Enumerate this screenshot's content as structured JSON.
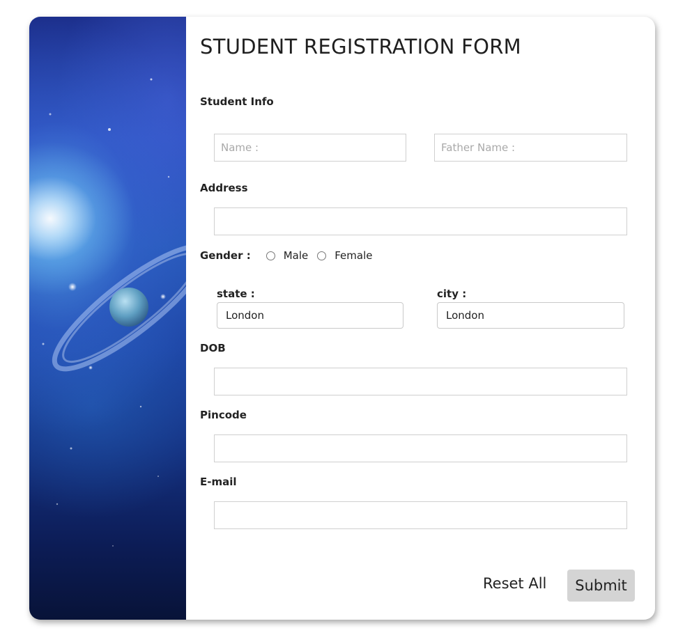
{
  "form": {
    "title": "STUDENT REGISTRATION FORM",
    "sections": {
      "student_info": "Student Info",
      "address": "Address",
      "gender": "Gender :",
      "state": "state :",
      "city": "city :",
      "dob": "DOB",
      "pincode": "Pincode",
      "email": "E-mail"
    },
    "fields": {
      "name": {
        "placeholder": "Name :",
        "value": ""
      },
      "father_name": {
        "placeholder": "Father Name :",
        "value": ""
      },
      "address": {
        "placeholder": "",
        "value": ""
      },
      "dob": {
        "placeholder": "",
        "value": ""
      },
      "pincode": {
        "placeholder": "",
        "value": ""
      },
      "email": {
        "placeholder": "",
        "value": ""
      }
    },
    "gender_options": [
      "Male",
      "Female"
    ],
    "state_selected": "London",
    "city_selected": "London",
    "buttons": {
      "reset": "Reset All",
      "submit": "Submit"
    }
  },
  "colors": {
    "submit_bg": "#d4d4d4",
    "border": "#cfcfcf",
    "space_dark": "#0c1c55",
    "space_light": "#2b4dba"
  },
  "icons": {
    "side_image": "space-planet-image"
  }
}
